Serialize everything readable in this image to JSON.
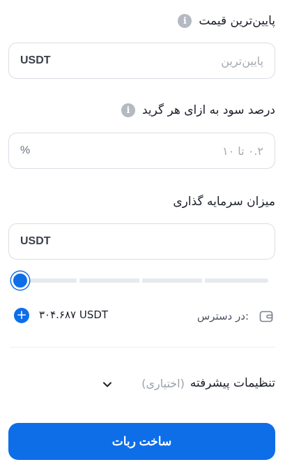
{
  "min_price": {
    "label": "پایین‌ترین قیمت",
    "placeholder": "پایین‌ترین",
    "unit": "USDT"
  },
  "grid_profit": {
    "label": "درصد سود به ازای هر گرید",
    "placeholder": "۰.۲ تا ۱۰",
    "unit": "%"
  },
  "investment": {
    "label": "میزان سرمایه گذاری",
    "unit": "USDT",
    "slider_fraction": 0
  },
  "available": {
    "label": "در دسترس:",
    "amount": "۳۰۴.۶۸۷ USDT"
  },
  "advanced": {
    "label": "تنظیمات پیشرفته",
    "optional": "(اختیاری)"
  },
  "submit_label": "ساخت ربات",
  "colors": {
    "accent": "#0d6ee8",
    "info_icon": "#b5b9c2"
  }
}
